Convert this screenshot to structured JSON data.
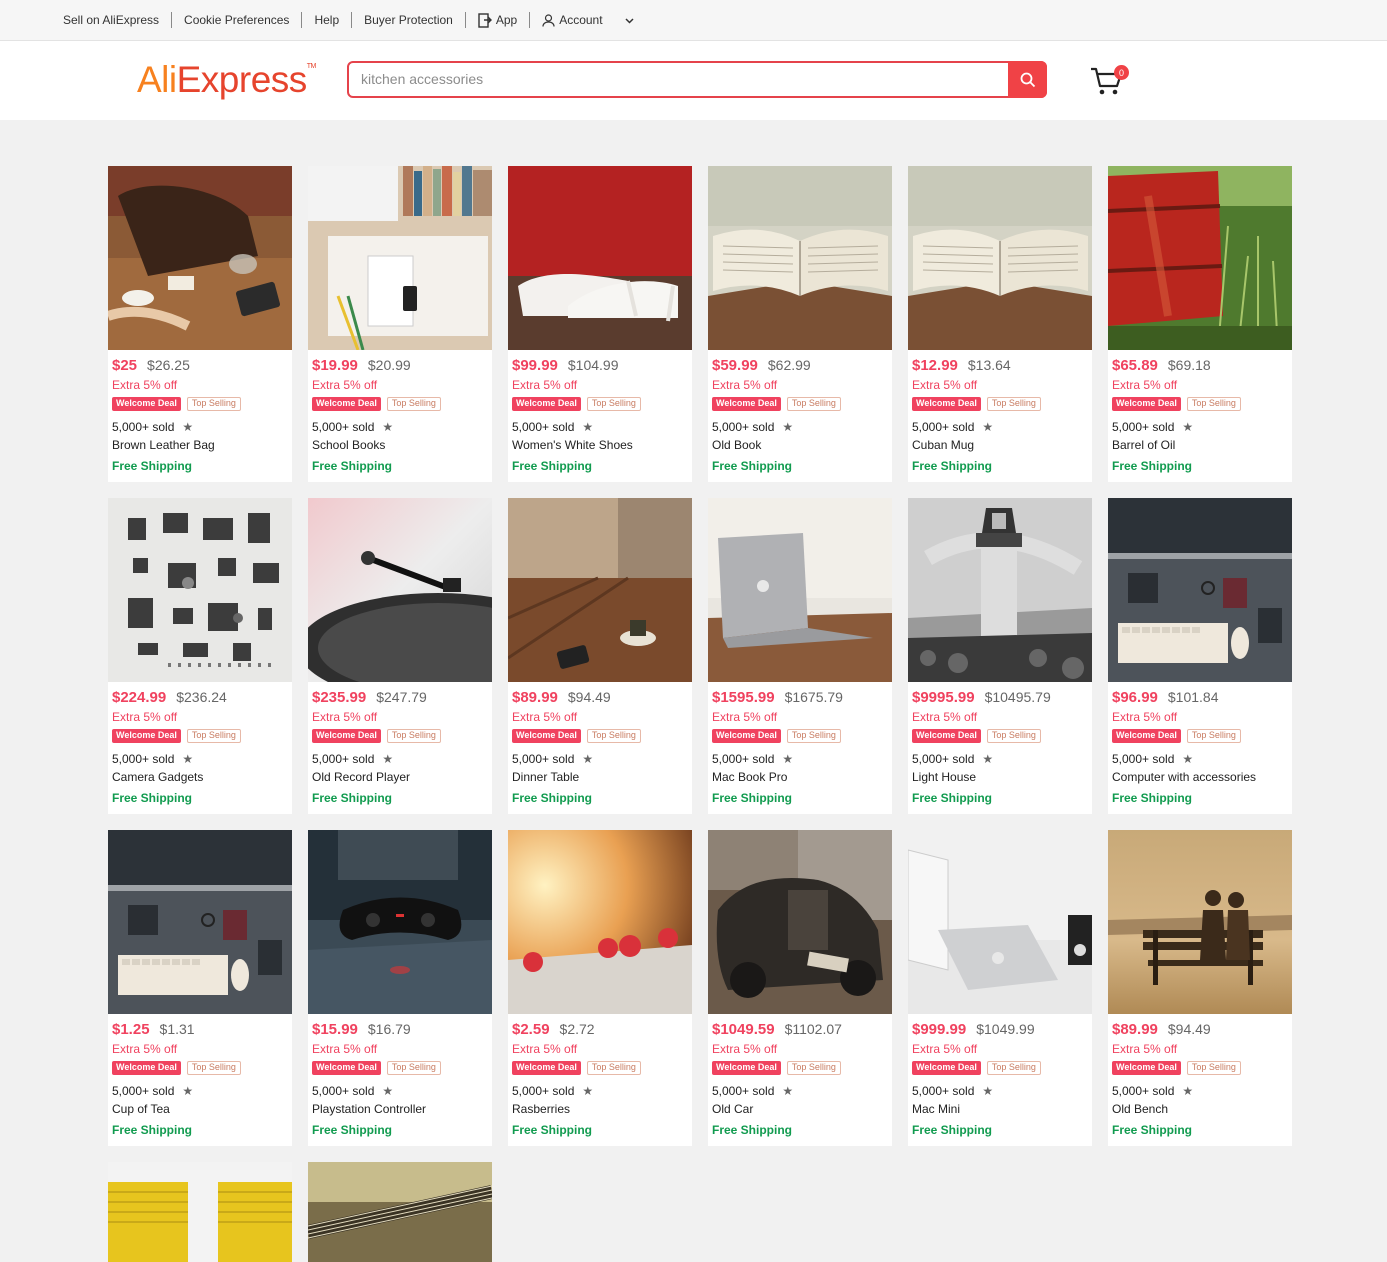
{
  "topbar": {
    "links": [
      "Sell on AliExpress",
      "Cookie Preferences",
      "Help",
      "Buyer Protection"
    ],
    "app_label": "App",
    "account_label": "Account"
  },
  "header": {
    "logo_ali": "Ali",
    "logo_express": "Express",
    "logo_tm": "TM",
    "search_placeholder": "kitchen accessories",
    "cart_count": "0"
  },
  "labels": {
    "extra": "Extra 5% off",
    "welcome": "Welcome Deal",
    "top": "Top Selling",
    "sold": "5,000+ sold",
    "ship": "Free Shipping"
  },
  "colors": {
    "accent": "#f0425f",
    "shipping": "#119b4f",
    "logo_orange": "#f7811f",
    "logo_red": "#e6442d"
  },
  "products": [
    {
      "price": "$25",
      "old": "$26.25",
      "name": "Brown Leather Bag",
      "img": "bag"
    },
    {
      "price": "$19.99",
      "old": "$20.99",
      "name": "School Books",
      "img": "books"
    },
    {
      "price": "$99.99",
      "old": "$104.99",
      "name": "Women's White Shoes",
      "img": "shoes"
    },
    {
      "price": "$59.99",
      "old": "$62.99",
      "name": "Old Book",
      "img": "book"
    },
    {
      "price": "$12.99",
      "old": "$13.64",
      "name": "Cuban Mug",
      "img": "book"
    },
    {
      "price": "$65.89",
      "old": "$69.18",
      "name": "Barrel of Oil",
      "img": "barrel"
    },
    {
      "price": "$224.99",
      "old": "$236.24",
      "name": "Camera Gadgets",
      "img": "gadgets"
    },
    {
      "price": "$235.99",
      "old": "$247.79",
      "name": "Old Record Player",
      "img": "record"
    },
    {
      "price": "$89.99",
      "old": "$94.49",
      "name": "Dinner Table",
      "img": "table"
    },
    {
      "price": "$1595.99",
      "old": "$1675.79",
      "name": "Mac Book Pro",
      "img": "macbook"
    },
    {
      "price": "$9995.99",
      "old": "$10495.79",
      "name": "Light House",
      "img": "lighthouse"
    },
    {
      "price": "$96.99",
      "old": "$101.84",
      "name": "Computer with accessories",
      "img": "desk"
    },
    {
      "price": "$1.25",
      "old": "$1.31",
      "name": "Cup of Tea",
      "img": "desk"
    },
    {
      "price": "$15.99",
      "old": "$16.79",
      "name": "Playstation Controller",
      "img": "controller"
    },
    {
      "price": "$2.59",
      "old": "$2.72",
      "name": "Rasberries",
      "img": "berries"
    },
    {
      "price": "$1049.59",
      "old": "$1102.07",
      "name": "Old Car",
      "img": "car"
    },
    {
      "price": "$999.99",
      "old": "$1049.99",
      "name": "Mac Mini",
      "img": "macmini"
    },
    {
      "price": "$89.99",
      "old": "$94.49",
      "name": "Old Bench",
      "img": "bench"
    }
  ],
  "partial_products": [
    {
      "img": "yellow"
    },
    {
      "img": "guitar"
    }
  ]
}
